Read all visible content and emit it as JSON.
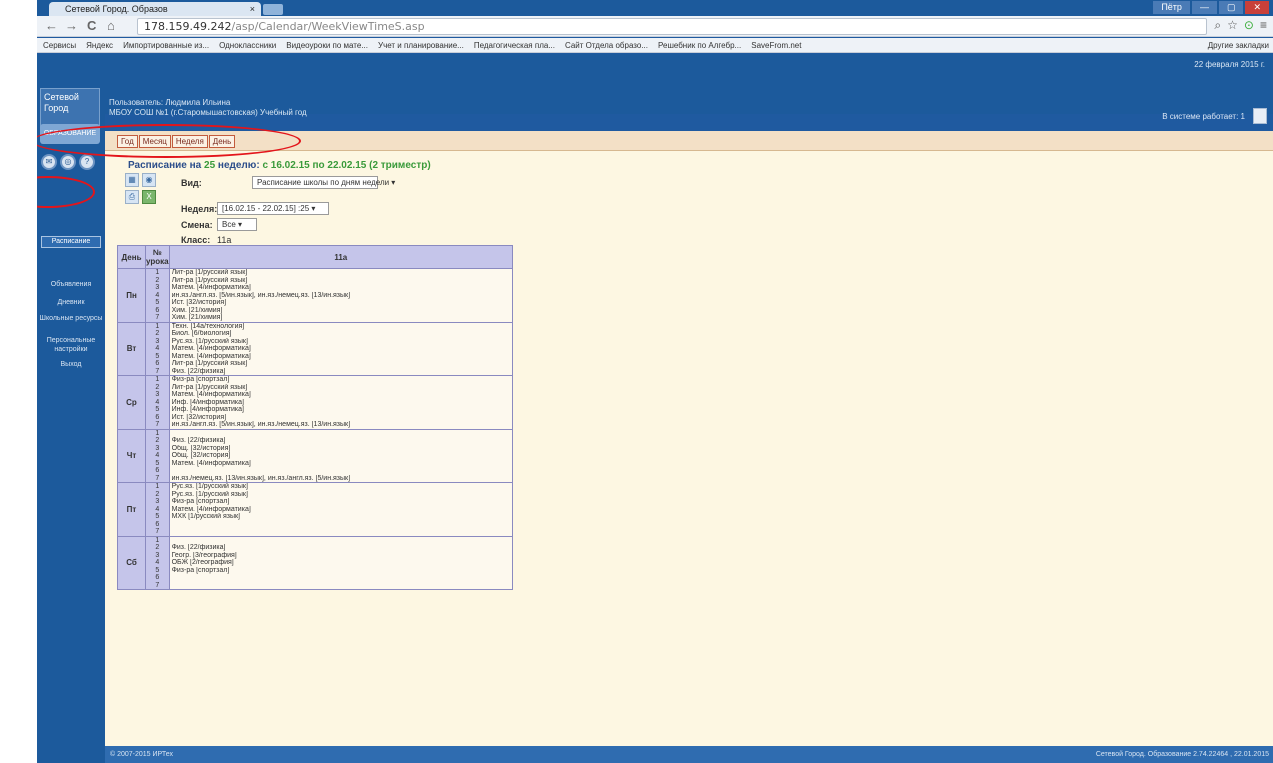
{
  "browser": {
    "tab_title": "Сетевой Город. Образов",
    "tab_close": "×",
    "url_host": "178.159.49.242",
    "url_path": "/asp/Calendar/WeekViewTimeS.asp",
    "window_controls": [
      "Пётр",
      "—",
      "▢",
      "✕"
    ],
    "bookmarks": [
      "Сервисы",
      "Яндекс",
      "Импортированные из...",
      "Одноклассники",
      "Видеоуроки по мате...",
      "Учет и планирование...",
      "Педагогическая пла...",
      "Сайт Отдела образо...",
      "Решебник по Алгебр...",
      "SaveFrom.net"
    ],
    "other_bookmarks": "Другие закладки"
  },
  "sidebar": {
    "logo": "Сетевой Город",
    "logo_badge": "ОБРАЗОВАНИЕ",
    "items": [
      "Расписание",
      "Объявления",
      "Дневник",
      "Школьные ресурсы",
      "Персональные настройки",
      "Выход"
    ]
  },
  "header": {
    "user_line1": "Пользователь: Людмила Ильина",
    "user_line2": "МБОУ СОШ №1 (г.Старомышастовская)   Учебный год",
    "date": "22 февраля 2015 г.",
    "works": "В системе работает: 1"
  },
  "modes": [
    "Год",
    "Месяц",
    "Неделя",
    "День"
  ],
  "schedule": {
    "title_prefix": "Расписание на",
    "week_no": "25",
    "title_mid": "неделю:",
    "dates": "с 16.02.15 по 22.02.15 (2 триместр)",
    "view_label": "Вид:",
    "view_value": "Расписание школы по дням недели",
    "week_label": "Неделя:",
    "week_value": "[16.02.15 - 22.02.15] :25",
    "shift_label": "Смена:",
    "shift_value": "Все",
    "class_label": "Класс:",
    "class_value": "11а",
    "col_day": "День",
    "col_no": "№ урока",
    "col_class": "11а",
    "days": [
      {
        "name": "Пн",
        "nums": [
          "1",
          "2",
          "3",
          "4",
          "5",
          "6",
          "7"
        ],
        "lessons": [
          "Лит-ра [1/русский язык]",
          "Лит-ра [1/русский язык]",
          "Матем. [4/информатика]",
          "ин.яз./англ.яз. [5/ин.язык], ин.яз./немец.яз. [13/ин.язык]",
          "Ист. [32/история]",
          "Хим. [21/химия]",
          "Хим. [21/химия]"
        ]
      },
      {
        "name": "Вт",
        "nums": [
          "1",
          "2",
          "3",
          "4",
          "5",
          "6",
          "7"
        ],
        "lessons": [
          "Техн. [14а/технология]",
          "Биол. [6/биология]",
          "Рус.яз. [1/русский язык]",
          "Матем. [4/информатика]",
          "Матем. [4/информатика]",
          "Лит-ра [1/русский язык]",
          "Физ. [22/физика]"
        ]
      },
      {
        "name": "Ср",
        "nums": [
          "1",
          "2",
          "3",
          "4",
          "5",
          "6",
          "7"
        ],
        "lessons": [
          "Физ-ра [спортзал]",
          "Лит-ра [1/русский язык]",
          "Матем. [4/информатика]",
          "Инф. [4/информатика]",
          "Инф. [4/информатика]",
          "Ист. [32/история]",
          "ин.яз./англ.яз. [5/ин.язык], ин.яз./немец.яз. [13/ин.язык]"
        ]
      },
      {
        "name": "Чт",
        "nums": [
          "1",
          "2",
          "3",
          "4",
          "5",
          "6",
          "7"
        ],
        "lessons": [
          "",
          "Физ. [22/физика]",
          "Общ. [32/история]",
          "Общ. [32/история]",
          "Матем. [4/информатика]",
          "",
          "ин.яз./немец.яз. [13/ин.язык], ин.яз./англ.яз. [5/ин.язык]"
        ]
      },
      {
        "name": "Пт",
        "nums": [
          "1",
          "2",
          "3",
          "4",
          "5",
          "6",
          "7"
        ],
        "lessons": [
          "Рус.яз. [1/русский язык]",
          "Рус.яз. [1/русский язык]",
          "Физ-ра [спортзал]",
          "Матем. [4/информатика]",
          "МХК [1/русский язык]",
          "",
          ""
        ]
      },
      {
        "name": "Сб",
        "nums": [
          "1",
          "2",
          "3",
          "4",
          "5",
          "6",
          "7"
        ],
        "lessons": [
          "",
          "Физ. [22/физика]",
          "Геогр. [3/география]",
          "ОБЖ [2/география]",
          "Физ-ра [спортзал]",
          "",
          ""
        ]
      }
    ]
  },
  "footer": {
    "left": "© 2007-2015 ИРТех",
    "right": "Сетевой Город. Образование 2.74.22464 , 22.01.2015"
  },
  "colors": {
    "chrome_blue": "#1c5a9c",
    "content_bg": "#fdf7e2",
    "table_head": "#c5c5ea",
    "annotation": "#e3151b"
  }
}
